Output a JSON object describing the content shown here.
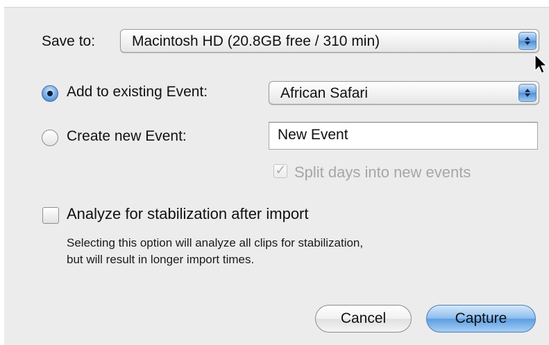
{
  "save_to": {
    "label": "Save to:",
    "selected": "Macintosh HD (20.8GB free / 310 min)"
  },
  "event": {
    "existing_label": "Add to existing Event:",
    "existing_selected": "African Safari",
    "new_label": "Create new Event:",
    "new_value": "New Event",
    "split_label": "Split days into new events",
    "split_checked": true,
    "mode": "existing"
  },
  "stabilization": {
    "label": "Analyze for stabilization after import",
    "checked": false,
    "description_line1": "Selecting this option will analyze all clips for stabilization,",
    "description_line2": "but will result in longer import times."
  },
  "buttons": {
    "cancel": "Cancel",
    "capture": "Capture"
  },
  "colors": {
    "accent": "#5d9de2",
    "dialog_bg": "#ececec"
  },
  "icons": [
    "popup-arrows-icon",
    "checkmark-icon",
    "mouse-pointer-icon"
  ]
}
